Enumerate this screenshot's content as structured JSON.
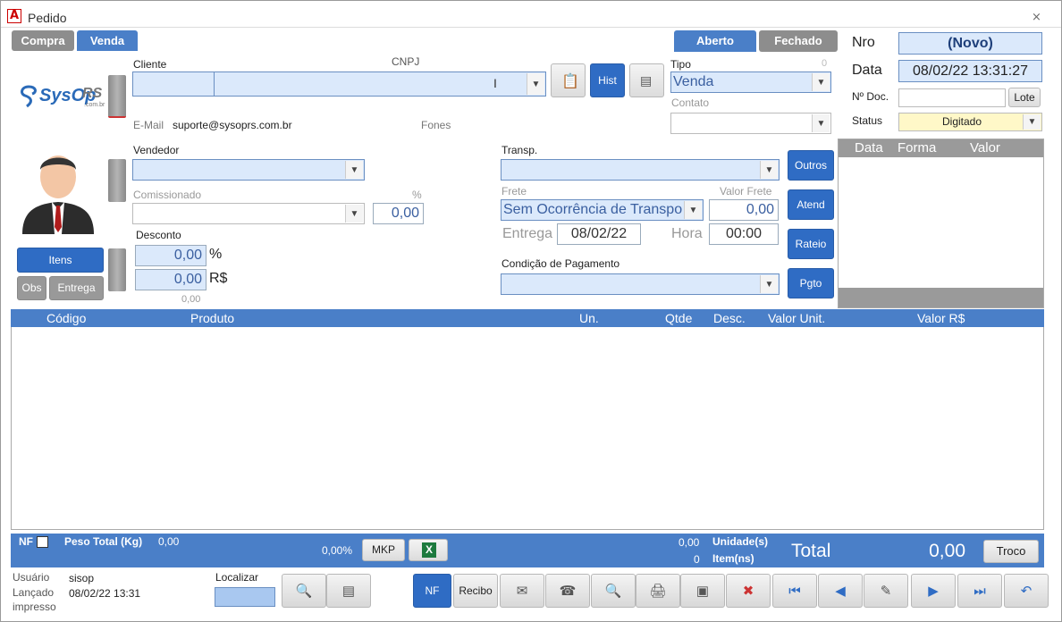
{
  "window": {
    "title": "Pedido",
    "app_icon": "A",
    "close": "⨯"
  },
  "tabs": {
    "compra": "Compra",
    "venda": "Venda",
    "aberto": "Aberto",
    "fechado": "Fechado"
  },
  "logo": {
    "text": "SysOp",
    "suffix": "RS",
    "sub": ".com.br"
  },
  "cliente": {
    "label": "Cliente",
    "cnpj_label": "CNPJ",
    "email_label": "E-Mail",
    "email": "suporte@sysoprs.com.br",
    "fones_label": "Fones",
    "hist": "Hist"
  },
  "tipo": {
    "label": "Tipo",
    "count": "0",
    "value": "Venda",
    "contato_label": "Contato"
  },
  "header_info": {
    "nro_label": "Nro",
    "nro": "(Novo)",
    "data_label": "Data",
    "data": "08/02/22 13:31:27",
    "doc_label": "Nº Doc.",
    "lote": "Lote",
    "status_label": "Status",
    "status": "Digitado"
  },
  "vendedor": {
    "label": "Vendedor",
    "comissionado_label": "Comissionado",
    "pct_label": "%",
    "pct": "0,00"
  },
  "desconto": {
    "label": "Desconto",
    "pct": "0,00",
    "pct_unit": "%",
    "valor": "0,00",
    "valor_unit": "R$",
    "sub": "0,00"
  },
  "buttons_left": {
    "itens": "Itens",
    "obs": "Obs",
    "entrega": "Entrega"
  },
  "transp": {
    "label": "Transp.",
    "frete_label": "Frete",
    "valor_frete_label": "Valor Frete",
    "frete": "Sem Ocorrência de Transpo",
    "valor_frete": "0,00",
    "entrega_label": "Entrega",
    "entrega": "08/02/22",
    "hora_label": "Hora",
    "hora": "00:00",
    "cond_label": "Condição de Pagamento"
  },
  "side_buttons": {
    "outros": "Outros",
    "atend": "Atend",
    "rateio": "Rateio",
    "pgto": "Pgto"
  },
  "pay_grid": {
    "cols": [
      "Data",
      "Forma",
      "Valor"
    ]
  },
  "items_grid": {
    "cols": [
      "Código",
      "Produto",
      "Un.",
      "Qtde",
      "Desc.",
      "Valor Unit.",
      "Valor R$"
    ]
  },
  "status_bar": {
    "nf": "NF",
    "peso_label": "Peso Total (Kg)",
    "peso": "0,00",
    "pct": "0,00%",
    "mkp": "MKP",
    "xls": "X",
    "unid_val": "0,00",
    "unid_label": "Unidade(s)",
    "item_val": "0",
    "item_label": "Item(ns)",
    "total_label": "Total",
    "total": "0,00",
    "troco": "Troco"
  },
  "footer": {
    "usuario_label": "Usuário",
    "usuario": "sisop",
    "lancado_label": "Lançado",
    "lancado": "08/02/22 13:31",
    "impresso_label": "impresso",
    "localizar": "Localizar",
    "nf": "NF",
    "recibo": "Recibo"
  }
}
